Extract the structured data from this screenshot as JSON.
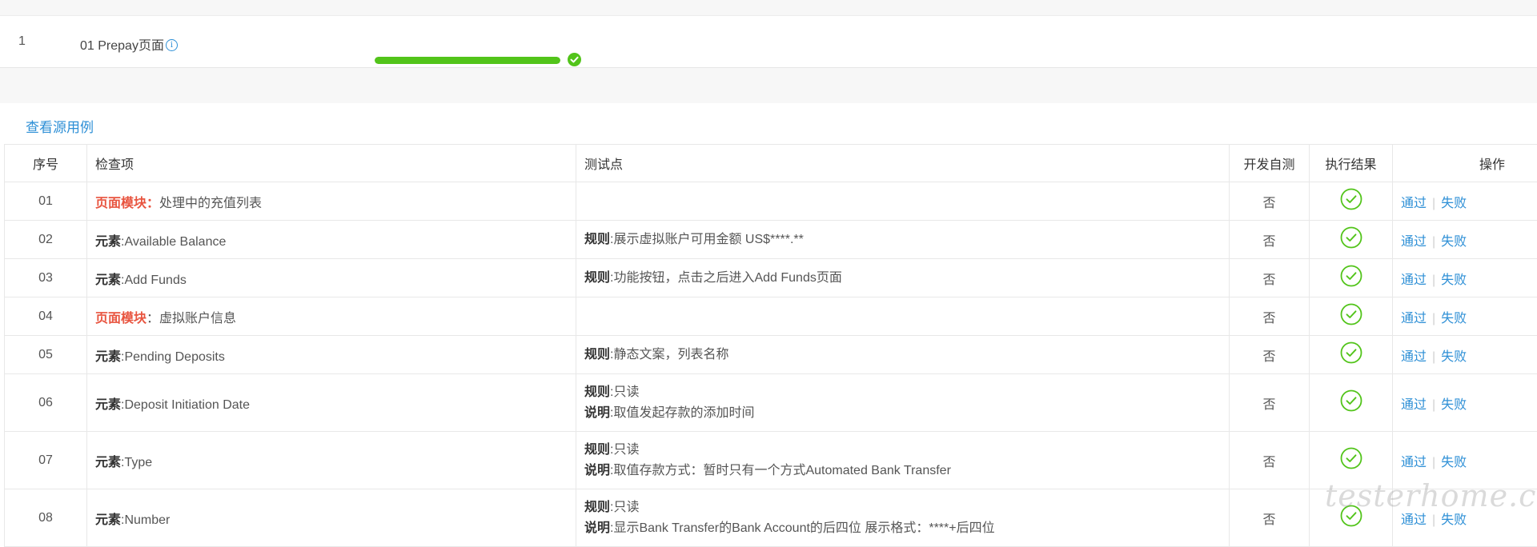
{
  "summary": {
    "index": "1",
    "name": "01 Prepay页面",
    "progress": 1.0
  },
  "link_text": "查看源用例",
  "table": {
    "headers": {
      "seq": "序号",
      "item": "检查项",
      "point": "测试点",
      "dev": "开发自测",
      "result": "执行结果",
      "ops": "操作"
    },
    "rows": [
      {
        "seq": "01",
        "type": "module",
        "item_label": "页面模块：",
        "item_text": "处理中的充值列表",
        "lines": [],
        "dev": "否"
      },
      {
        "seq": "02",
        "type": "element",
        "item_label": "元素",
        "item_text": ":Available Balance",
        "lines": [
          {
            "label": "规则",
            "text": ":展示虚拟账户可用金额   US$****.**"
          }
        ],
        "dev": "否"
      },
      {
        "seq": "03",
        "type": "element",
        "item_label": "元素",
        "item_text": ":Add Funds",
        "lines": [
          {
            "label": "规则",
            "text": ":功能按钮，点击之后进入Add Funds页面"
          }
        ],
        "dev": "否"
      },
      {
        "seq": "04",
        "type": "module",
        "item_label": "页面模块",
        "item_text": "：虚拟账户信息",
        "lines": [],
        "dev": "否"
      },
      {
        "seq": "05",
        "type": "element",
        "item_label": "元素",
        "item_text": ":Pending Deposits",
        "lines": [
          {
            "label": "规则",
            "text": ":静态文案，列表名称"
          }
        ],
        "dev": "否"
      },
      {
        "seq": "06",
        "type": "element",
        "item_label": "元素",
        "item_text": ":Deposit Initiation Date",
        "lines": [
          {
            "label": "规则",
            "text": ":只读"
          },
          {
            "label": "说明",
            "text": ":取值发起存款的添加时间"
          }
        ],
        "dev": "否"
      },
      {
        "seq": "07",
        "type": "element",
        "item_label": "元素",
        "item_text": ":Type",
        "lines": [
          {
            "label": "规则",
            "text": ":只读"
          },
          {
            "label": "说明",
            "text": ":取值存款方式：暂时只有一个方式Automated Bank Transfer"
          }
        ],
        "dev": "否"
      },
      {
        "seq": "08",
        "type": "element",
        "item_label": "元素",
        "item_text": ":Number",
        "lines": [
          {
            "label": "规则",
            "text": ":只读"
          },
          {
            "label": "说明",
            "text": ":显示Bank Transfer的Bank Account的后四位 展示格式：****+后四位"
          }
        ],
        "dev": "否"
      }
    ],
    "pass_label": "通过",
    "fail_label": "失败"
  },
  "watermark": "testerhome.com",
  "colors": {
    "accent": "#2d8fd6",
    "success": "#52c41a",
    "module_red": "#e8543f"
  },
  "icons": {
    "result": "check-circle-icon",
    "info": "info-icon"
  }
}
